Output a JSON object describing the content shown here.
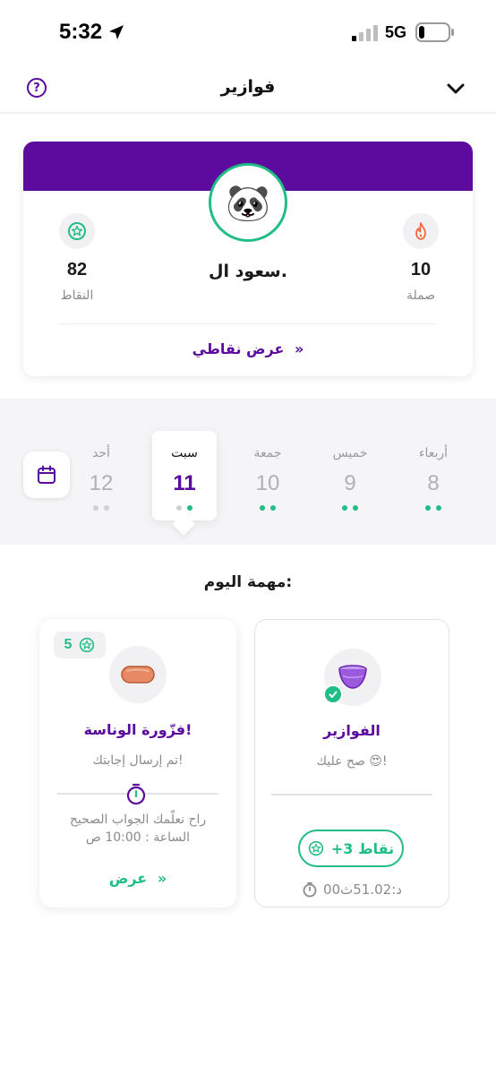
{
  "status_bar": {
    "time": "5:32",
    "network": "5G"
  },
  "header": {
    "title": "فوازير",
    "help_icon_label": "?"
  },
  "profile": {
    "avatar_emoji": "🐼",
    "name": "سعود ال.",
    "streak_value": "10",
    "streak_label": "صملة",
    "points_value": "82",
    "points_label": "النقاط",
    "view_points_label": "عرض نقاطي"
  },
  "days": [
    {
      "name": "أربعاء",
      "num": "8",
      "dots": [
        "green",
        "green"
      ]
    },
    {
      "name": "خميس",
      "num": "9",
      "dots": [
        "green",
        "green"
      ]
    },
    {
      "name": "جمعة",
      "num": "10",
      "dots": [
        "green",
        "green"
      ]
    },
    {
      "name": "سبت",
      "num": "11",
      "dots": [
        "gray",
        "green"
      ],
      "selected": true
    },
    {
      "name": "أحد",
      "num": "12",
      "dots": [
        "gray",
        "gray"
      ]
    }
  ],
  "tasks": {
    "title": "مهمة اليوم:",
    "riddles": {
      "title": "الفوازير",
      "subtitle": "صح عليك 😍!",
      "points_badge": "+3 نقاط",
      "timer": "00د:51.02ث"
    },
    "challenge": {
      "reward": "5",
      "title": "فزّورة الوناسة!",
      "subtitle": "تم إرسال إجابتك!",
      "reveal_line1": "راح نعلّمك الجواب الصحيح",
      "reveal_line2": "الساعة : 10:00 ص",
      "view_label": "عرض"
    }
  },
  "colors": {
    "brand_purple": "#5d0b9e",
    "accent_green": "#21bd86",
    "streak_orange": "#f26b3a"
  }
}
